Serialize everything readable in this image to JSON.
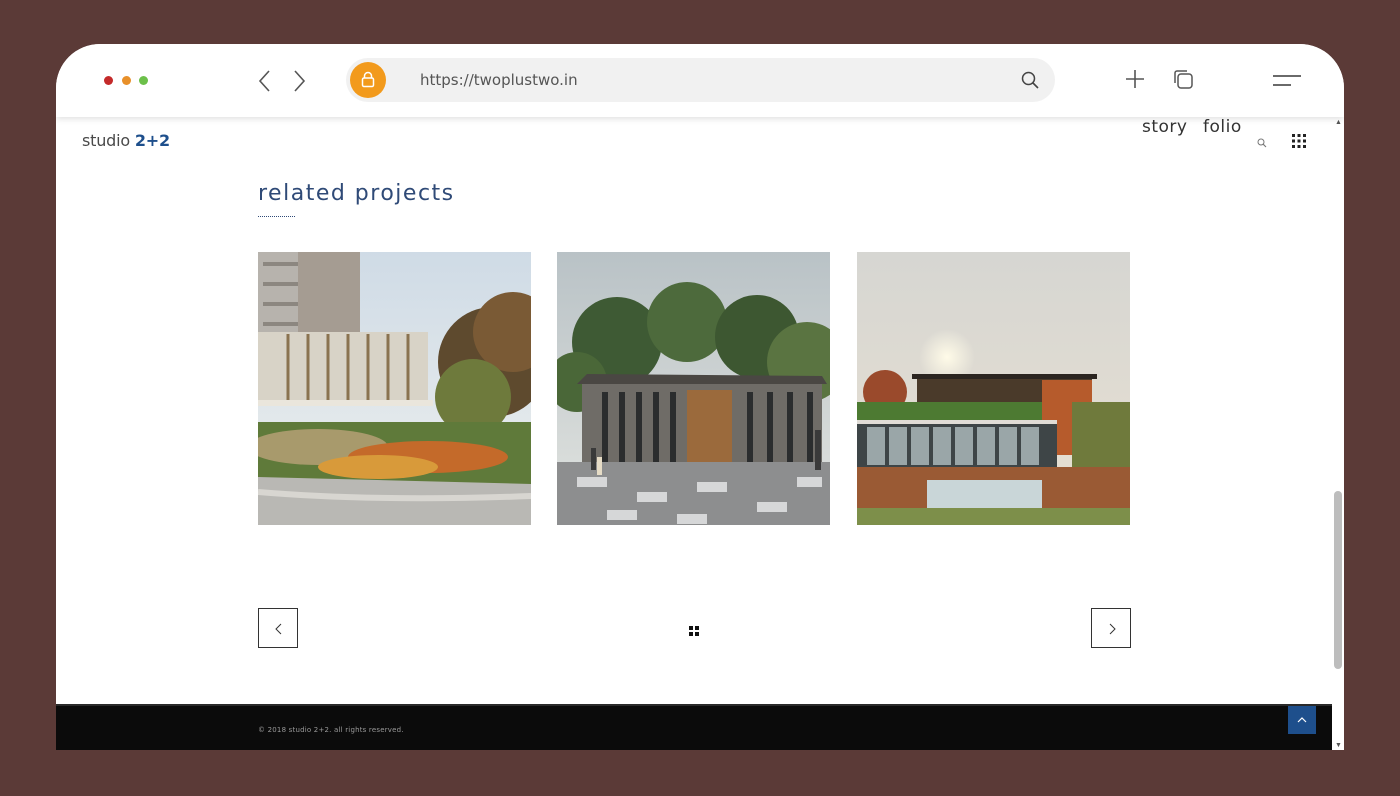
{
  "browser": {
    "url": "https://twoplustwo.in",
    "window_dots": [
      "red",
      "orange",
      "green"
    ],
    "icons": {
      "back": "chevron-left-icon",
      "forward": "chevron-right-icon",
      "lock": "lock-icon",
      "search": "search-icon",
      "new_tab": "plus-icon",
      "tabs": "tabs-icon",
      "menu": "menu-icon"
    },
    "colors": {
      "lock_button": "#f29a1c",
      "frame_bg": "#5b3a37"
    }
  },
  "site": {
    "logo_text": "studio ",
    "logo_accent": "2+2",
    "nav": {
      "story": "story",
      "folio": "folio"
    },
    "icons": {
      "search": "search-icon",
      "grid_menu": "grid-menu-icon"
    },
    "colors": {
      "accent": "#1e4f8c",
      "title": "#2f4a77"
    }
  },
  "related": {
    "title": "related projects",
    "projects": [
      {
        "image": "residential-tower-clubhouse-render"
      },
      {
        "image": "aurum-pavilion-render"
      },
      {
        "image": "villa-with-pool-render"
      }
    ]
  },
  "pager": {
    "prev_icon": "chevron-left-icon",
    "next_icon": "chevron-right-icon",
    "grid_icon": "grid-icon"
  },
  "footer": {
    "copyright": "© 2018 studio 2+2. all rights reserved.",
    "back_to_top_icon": "chevron-up-icon"
  }
}
